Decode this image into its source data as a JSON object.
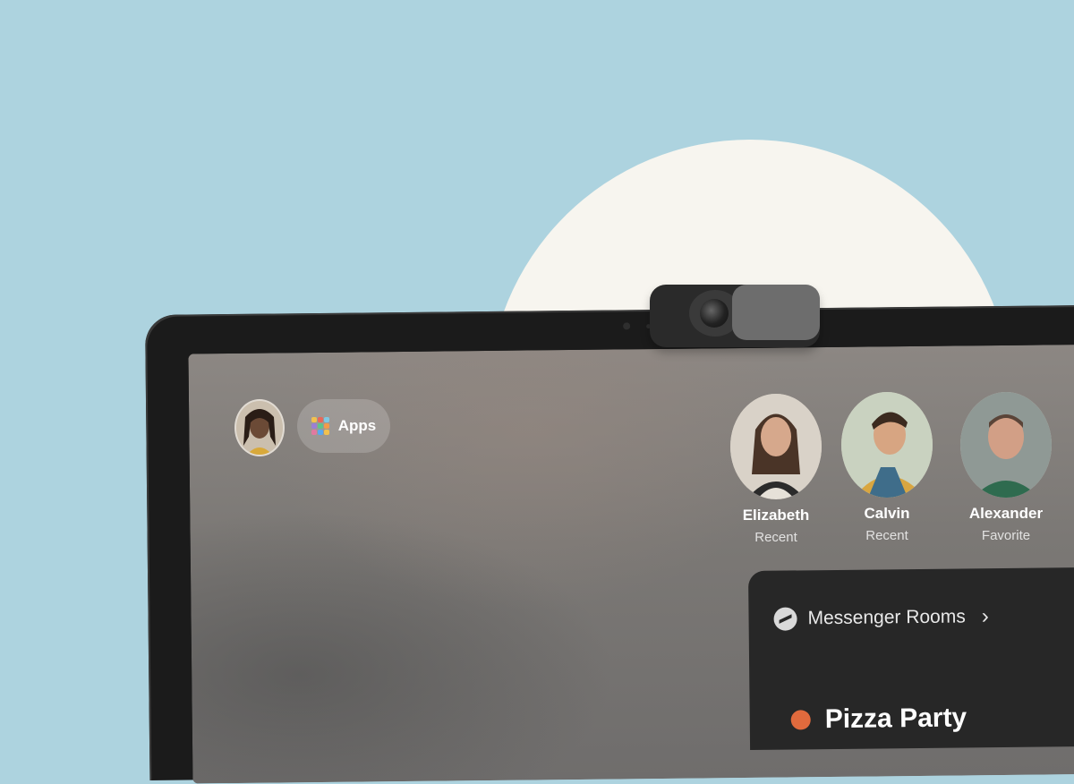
{
  "home": {
    "apps_label": "Apps"
  },
  "contacts": [
    {
      "name": "Elizabeth",
      "status": "Recent"
    },
    {
      "name": "Calvin",
      "status": "Recent"
    },
    {
      "name": "Alexander",
      "status": "Favorite"
    }
  ],
  "rooms": {
    "title": "Messenger Rooms",
    "peek_text": "Pizza Party"
  },
  "icons": {
    "apps": "apps-grid-icon",
    "messenger": "messenger-icon",
    "chevron": "chevron-right-icon",
    "pizza": "pizza-icon"
  },
  "colors": {
    "background": "#add3df",
    "sun": "#f7f5ef",
    "device": "#1b1b1b",
    "card": "#272727"
  }
}
